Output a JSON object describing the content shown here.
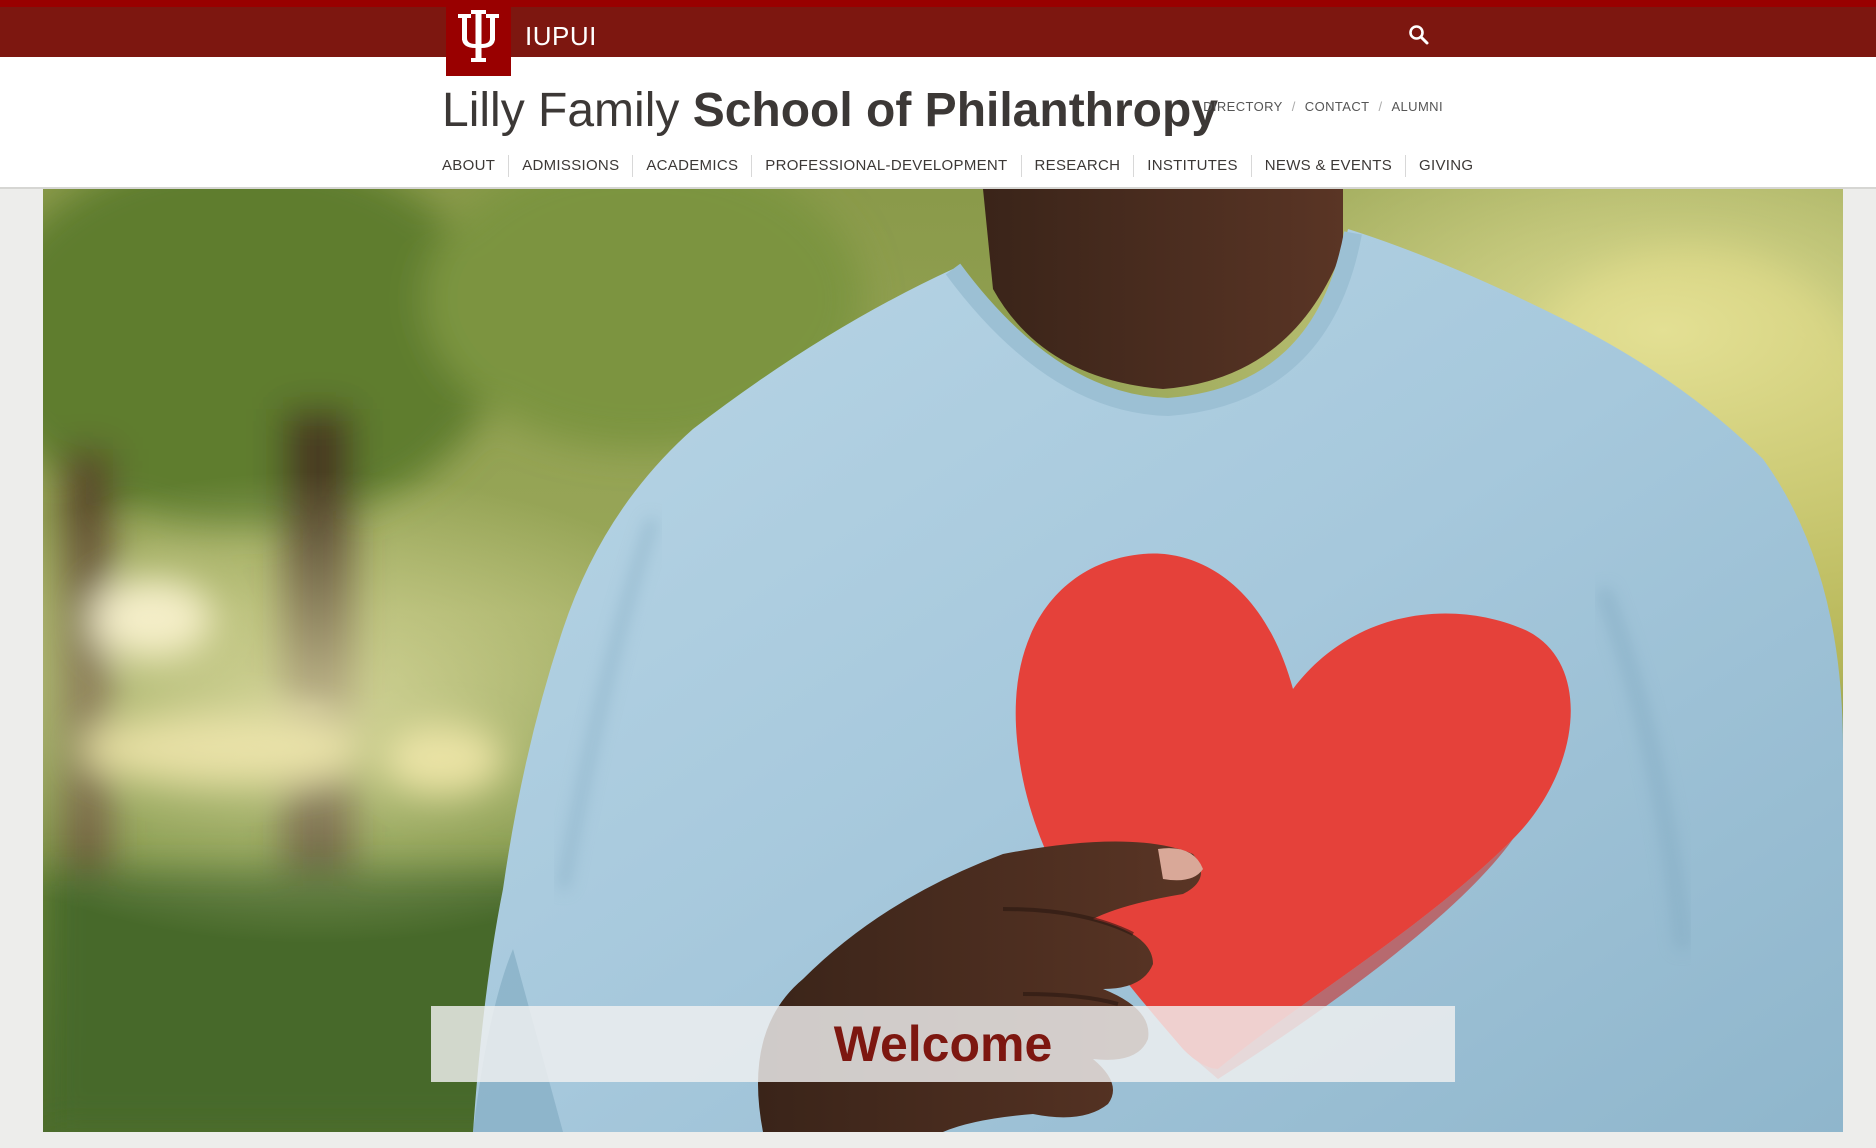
{
  "topbar": {
    "campus_label": "IUPUI",
    "logo_icon": "iu-trident-icon",
    "search_icon": "search-icon",
    "bar_color": "#7d1710",
    "accent_color": "#990000"
  },
  "header": {
    "title_light": "Lilly Family ",
    "title_bold": "School of Philanthropy",
    "utility_nav": [
      "DIRECTORY",
      "CONTACT",
      "ALUMNI"
    ],
    "utility_separator": "/",
    "main_nav": [
      "ABOUT",
      "ADMISSIONS",
      "ACADEMICS",
      "PROFESSIONAL-DEVELOPMENT",
      "RESEARCH",
      "INSTITUTES",
      "NEWS & EVENTS",
      "GIVING"
    ]
  },
  "hero": {
    "welcome": "Welcome",
    "welcome_color": "#7d1710"
  }
}
